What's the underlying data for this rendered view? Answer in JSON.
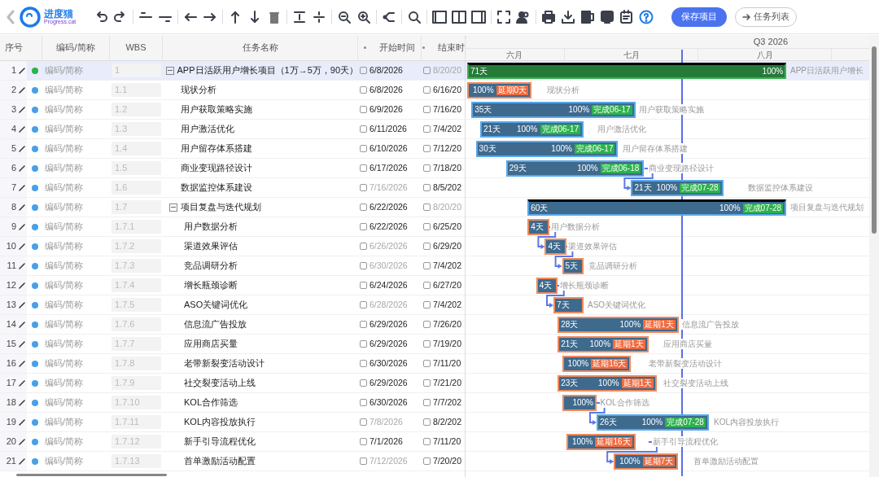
{
  "toolbar": {
    "logo": {
      "name": "进度猫",
      "tagline": "Progress.cat"
    },
    "buttons": [
      {
        "label": "保存项目",
        "kind": "primary"
      },
      {
        "label": "任务列表",
        "kind": "secondary"
      }
    ]
  },
  "table": {
    "columns": [
      "序号",
      "编码/简称",
      "WBS",
      "任务名称",
      "开始时间",
      "结束时"
    ]
  },
  "timeline": {
    "quarter": "Q3 2026",
    "months": [
      "六月",
      "七月",
      "八月"
    ]
  },
  "tasks": [
    {
      "no": "1",
      "code": "编码/简称",
      "wbs": "1",
      "name": "APP日活跃用户增长项目（1万→5万，90天）",
      "start": "6/8/2026",
      "start_dim": false,
      "end": "8/20/20",
      "end_dim": true,
      "color": "#2bb24c",
      "selected": true,
      "expanded": true,
      "bar": {
        "kind": "project",
        "duration": "71天",
        "percent": "100%",
        "late": false,
        "label": "APP日活跃用户增长",
        "linked": false
      },
      "children": [
        {
          "no": "2",
          "code": "编码/简称",
          "wbs": "1.1",
          "name": "现状分析",
          "start": "6/8/2026",
          "start_dim": false,
          "end": "6/16/20",
          "end_dim": false,
          "color": "#4a9fe8",
          "selected": false,
          "bar": {
            "kind": "task",
            "percent": "100%",
            "badge": "延期0天",
            "late": true,
            "label": "现状分析",
            "linked": false
          }
        },
        {
          "no": "3",
          "code": "编码/简称",
          "wbs": "1.2",
          "name": "用户获取策略实施",
          "start": "6/9/2026",
          "start_dim": false,
          "end": "7/16/20",
          "end_dim": false,
          "color": "#4a9fe8",
          "selected": false,
          "bar": {
            "kind": "task",
            "duration": "35天",
            "percent": "100%",
            "badge": "完成06-17",
            "late": false,
            "label": "用户获取策略实施",
            "linked": false
          }
        },
        {
          "no": "4",
          "code": "编码/简称",
          "wbs": "1.3",
          "name": "用户激活优化",
          "start": "6/11/2026",
          "start_dim": false,
          "end": "7/4/202",
          "end_dim": false,
          "color": "#4a9fe8",
          "selected": false,
          "bar": {
            "kind": "task",
            "duration": "21天",
            "percent": "100%",
            "badge": "完成06-17",
            "late": false,
            "label": "用户激活优化",
            "linked": false
          }
        },
        {
          "no": "5",
          "code": "编码/简称",
          "wbs": "1.4",
          "name": "用户留存体系搭建",
          "start": "6/10/2026",
          "start_dim": false,
          "end": "7/12/20",
          "end_dim": false,
          "color": "#4a9fe8",
          "selected": false,
          "bar": {
            "kind": "task",
            "duration": "30天",
            "percent": "100%",
            "badge": "完成06-17",
            "late": false,
            "label": "用户留存体系搭建",
            "linked": false
          }
        },
        {
          "no": "6",
          "code": "编码/简称",
          "wbs": "1.5",
          "name": "商业变现路径设计",
          "start": "6/17/2026",
          "start_dim": false,
          "end": "7/18/20",
          "end_dim": false,
          "color": "#4a9fe8",
          "selected": false,
          "bar": {
            "kind": "task",
            "duration": "29天",
            "percent": "100%",
            "badge": "完成06-18",
            "late": false,
            "label": "商业变现路径设计",
            "linked": false
          }
        },
        {
          "no": "7",
          "code": "编码/简称",
          "wbs": "1.6",
          "name": "数据监控体系建设",
          "start": "7/16/2026",
          "start_dim": true,
          "end": "8/5/202",
          "end_dim": false,
          "color": "#4a9fe8",
          "selected": false,
          "bar": {
            "kind": "task",
            "duration": "21天",
            "percent": "100%",
            "badge": "完成07-28",
            "late": false,
            "label": "数据监控体系建设",
            "linked": true
          }
        },
        {
          "no": "8",
          "code": "编码/简称",
          "wbs": "1.7",
          "name": "项目复盘与迭代规划",
          "start": "6/22/2026",
          "start_dim": false,
          "end": "8/20/20",
          "end_dim": true,
          "color": "#4a9fe8",
          "selected": false,
          "expanded": true,
          "bar": {
            "kind": "summary",
            "duration": "60天",
            "percent": "100%",
            "badge": "完成07-28",
            "late": false,
            "label": "项目复盘与迭代规划",
            "linked": false
          },
          "children": [
            {
              "no": "9",
              "code": "编码/简称",
              "wbs": "1.7.1",
              "name": "用户数据分析",
              "start": "6/22/2026",
              "start_dim": false,
              "end": "6/25/20",
              "end_dim": false,
              "color": "#4a9fe8",
              "selected": false,
              "bar": {
                "kind": "task",
                "duration": "4天",
                "late": true,
                "label": "用户数据分析",
                "linked": false
              }
            },
            {
              "no": "10",
              "code": "编码/简称",
              "wbs": "1.7.2",
              "name": "渠道效果评估",
              "start": "6/26/2026",
              "start_dim": true,
              "end": "6/29/20",
              "end_dim": false,
              "color": "#4a9fe8",
              "selected": false,
              "bar": {
                "kind": "task",
                "duration": "4天",
                "late": true,
                "label": "渠道效果评估",
                "linked": true
              }
            },
            {
              "no": "11",
              "code": "编码/简称",
              "wbs": "1.7.3",
              "name": "竞品调研分析",
              "start": "6/30/2026",
              "start_dim": true,
              "end": "7/4/202",
              "end_dim": false,
              "color": "#4a9fe8",
              "selected": false,
              "bar": {
                "kind": "task",
                "duration": "5天",
                "late": true,
                "label": "竞品调研分析",
                "linked": true
              }
            },
            {
              "no": "12",
              "code": "编码/简称",
              "wbs": "1.7.4",
              "name": "增长瓶颈诊断",
              "start": "6/24/2026",
              "start_dim": false,
              "end": "6/27/20",
              "end_dim": false,
              "color": "#4a9fe8",
              "selected": false,
              "bar": {
                "kind": "task",
                "duration": "4天",
                "late": true,
                "label": "增长瓶颈诊断",
                "linked": false
              }
            },
            {
              "no": "13",
              "code": "编码/简称",
              "wbs": "1.7.5",
              "name": "ASO关键词优化",
              "start": "6/28/2026",
              "start_dim": true,
              "end": "7/4/202",
              "end_dim": false,
              "color": "#4a9fe8",
              "selected": false,
              "bar": {
                "kind": "task",
                "duration": "7天",
                "late": true,
                "label": "ASO关键词优化",
                "linked": true
              }
            },
            {
              "no": "14",
              "code": "编码/简称",
              "wbs": "1.7.6",
              "name": "信息流广告投放",
              "start": "6/29/2026",
              "start_dim": false,
              "end": "7/26/20",
              "end_dim": false,
              "color": "#4a9fe8",
              "selected": false,
              "bar": {
                "kind": "task",
                "duration": "28天",
                "percent": "100%",
                "badge": "延期1天",
                "late": true,
                "label": "信息流广告投放",
                "linked": false
              }
            },
            {
              "no": "15",
              "code": "编码/简称",
              "wbs": "1.7.7",
              "name": "应用商店买量",
              "start": "6/29/2026",
              "start_dim": false,
              "end": "7/19/20",
              "end_dim": false,
              "color": "#4a9fe8",
              "selected": false,
              "bar": {
                "kind": "task",
                "duration": "21天",
                "percent": "100%",
                "badge": "延期1天",
                "late": true,
                "label": "应用商店买量",
                "linked": false
              }
            },
            {
              "no": "16",
              "code": "编码/简称",
              "wbs": "1.7.8",
              "name": "老带新裂变活动设计",
              "start": "6/30/2026",
              "start_dim": false,
              "end": "7/11/20",
              "end_dim": false,
              "color": "#4a9fe8",
              "selected": false,
              "bar": {
                "kind": "task",
                "percent": "100%",
                "badge": "延期16天",
                "late": true,
                "label": "老带新裂变活动设计",
                "linked": false
              }
            },
            {
              "no": "17",
              "code": "编码/简称",
              "wbs": "1.7.9",
              "name": "社交裂变活动上线",
              "start": "6/29/2026",
              "start_dim": false,
              "end": "7/21/20",
              "end_dim": false,
              "color": "#4a9fe8",
              "selected": false,
              "bar": {
                "kind": "task",
                "duration": "23天",
                "percent": "100%",
                "badge": "延期1天",
                "late": true,
                "label": "社交裂变活动上线",
                "linked": false
              }
            },
            {
              "no": "18",
              "code": "编码/简称",
              "wbs": "1.7.10",
              "name": "KOL合作筛选",
              "start": "6/30/2026",
              "start_dim": false,
              "end": "7/7/202",
              "end_dim": false,
              "color": "#4a9fe8",
              "selected": false,
              "bar": {
                "kind": "task",
                "percent": "100%",
                "late": true,
                "label": "KOL合作筛选",
                "linked": false
              }
            },
            {
              "no": "19",
              "code": "编码/简称",
              "wbs": "1.7.11",
              "name": "KOL内容投放执行",
              "start": "7/8/2026",
              "start_dim": true,
              "end": "8/2/202",
              "end_dim": false,
              "color": "#4a9fe8",
              "selected": false,
              "bar": {
                "kind": "task",
                "duration": "26天",
                "percent": "100%",
                "badge": "完成07-28",
                "late": false,
                "label": "KOL内容投放执行",
                "linked": true
              }
            },
            {
              "no": "20",
              "code": "编码/简称",
              "wbs": "1.7.12",
              "name": "新手引导流程优化",
              "start": "7/1/2026",
              "start_dim": false,
              "end": "7/11/20",
              "end_dim": false,
              "color": "#4a9fe8",
              "selected": false,
              "bar": {
                "kind": "task",
                "percent": "100%",
                "badge": "延期16天",
                "late": true,
                "label": "新手引导流程优化",
                "linked": false
              }
            },
            {
              "no": "21",
              "code": "编码/简称",
              "wbs": "1.7.13",
              "name": "首单激励活动配置",
              "start": "7/12/2026",
              "start_dim": true,
              "end": "7/20/20",
              "end_dim": false,
              "color": "#4a9fe8",
              "selected": false,
              "bar": {
                "kind": "task",
                "percent": "100%",
                "badge": "延期7天",
                "late": true,
                "label": "首单激励活动配置",
                "linked": true
              }
            }
          ]
        }
      ]
    }
  ]
}
